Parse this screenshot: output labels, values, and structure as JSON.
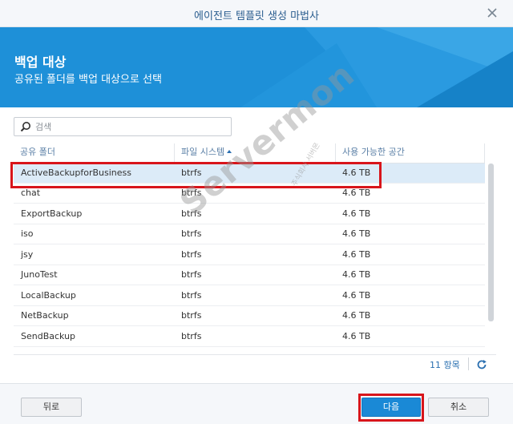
{
  "window": {
    "title": "에이전트 템플릿 생성 마법사"
  },
  "header": {
    "title": "백업 대상",
    "subtitle": "공유된 폴더를 백업 대상으로 선택"
  },
  "search": {
    "placeholder": "검색",
    "value": ""
  },
  "table": {
    "columns": [
      "공유 폴더",
      "파일 시스템",
      "사용 가능한 공간"
    ],
    "sorted_column": "파일 시스템",
    "rows": [
      {
        "name": "ActiveBackupforBusiness",
        "fs": "btrfs",
        "space": "4.6 TB",
        "selected": true
      },
      {
        "name": "chat",
        "fs": "btrfs",
        "space": "4.6 TB"
      },
      {
        "name": "ExportBackup",
        "fs": "btrfs",
        "space": "4.6 TB"
      },
      {
        "name": "iso",
        "fs": "btrfs",
        "space": "4.6 TB"
      },
      {
        "name": "jsy",
        "fs": "btrfs",
        "space": "4.6 TB"
      },
      {
        "name": "JunoTest",
        "fs": "btrfs",
        "space": "4.6 TB"
      },
      {
        "name": "LocalBackup",
        "fs": "btrfs",
        "space": "4.6 TB"
      },
      {
        "name": "NetBackup",
        "fs": "btrfs",
        "space": "4.6 TB"
      },
      {
        "name": "SendBackup",
        "fs": "btrfs",
        "space": "4.6 TB"
      }
    ],
    "item_count": "11 항목"
  },
  "footer": {
    "back_label": "뒤로",
    "next_label": "다음",
    "cancel_label": "취소"
  },
  "watermark": {
    "text": "Servermon",
    "subtext": "주식회사 서버몬"
  },
  "colors": {
    "accent": "#1a89d6",
    "banner": "#1e90d8",
    "highlight": "#d8151b",
    "selected_row": "#dcebf8"
  },
  "icons": {
    "close": "close-icon",
    "search": "search-icon",
    "sort": "sort-asc-icon",
    "refresh": "refresh-icon"
  }
}
